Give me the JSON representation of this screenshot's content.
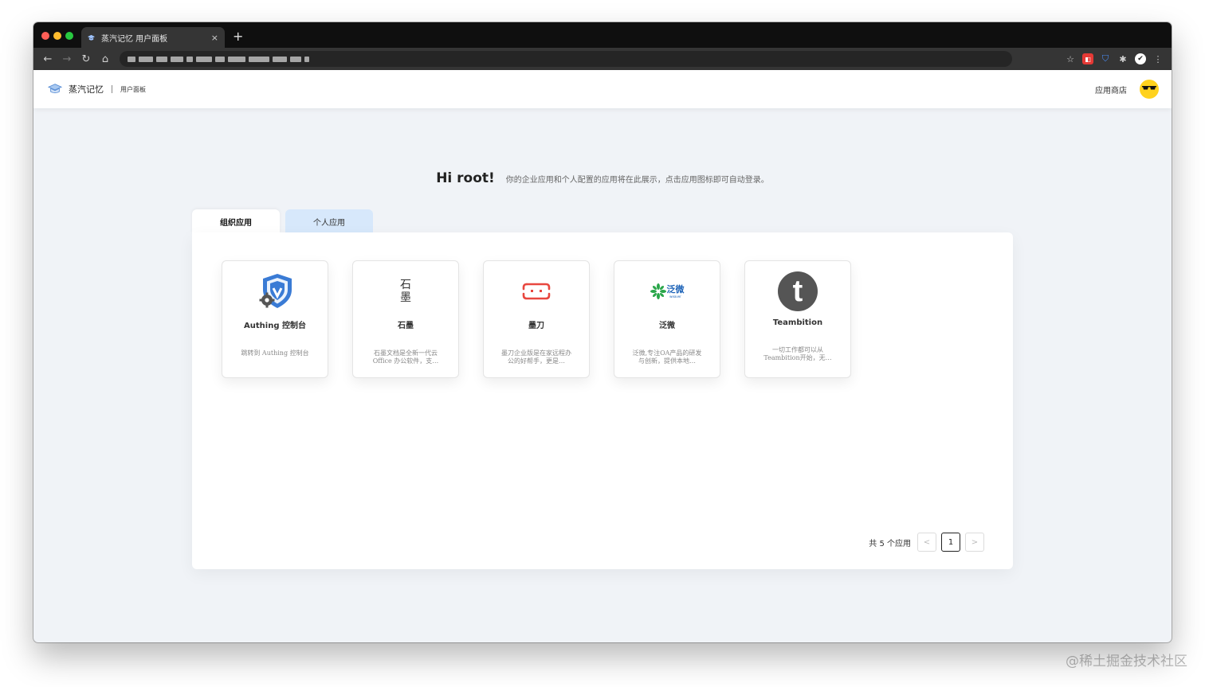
{
  "browser": {
    "tab_title": "蒸汽记忆 用户面板",
    "tab_close": "×",
    "new_tab": "+",
    "nav": {
      "back": "←",
      "forward": "→",
      "reload": "↻",
      "home": "⌂"
    },
    "extensions": {
      "star": "☆",
      "red_ext": "◧",
      "shield": "⛉",
      "puzzle": "✱",
      "profile": "✔",
      "more": "⋮"
    }
  },
  "header": {
    "brand": "蒸汽记忆",
    "divider": "|",
    "subtitle": "用户面板",
    "store_link": "应用商店"
  },
  "greeting": {
    "title": "Hi root!",
    "text": "你的企业应用和个人配置的应用将在此展示，点击应用图标即可自动登录。"
  },
  "tabs": [
    {
      "label": "组织应用",
      "active": true
    },
    {
      "label": "个人应用",
      "active": false
    }
  ],
  "apps": [
    {
      "name": "Authing 控制台",
      "desc": "跳转到 Authing 控制台",
      "icon": "authing-shield-gear-icon"
    },
    {
      "name": "石墨",
      "desc": "石墨文档是全新一代云Office 办公软件，支…",
      "icon": "shimo-logo-icon",
      "icon_text": "石\n墨"
    },
    {
      "name": "墨刀",
      "desc": "墨刀企业版是在家远程办公的好帮手，更是…",
      "icon": "modao-logo-icon"
    },
    {
      "name": "泛微",
      "desc": "泛微,专注OA产品的研发与创新，提供本地…",
      "icon": "weaver-logo-icon",
      "icon_text": "泛微",
      "icon_sub": "weaver"
    },
    {
      "name": "Teambition",
      "desc": "一切工作都可以从Teambition开始，无…",
      "icon": "teambition-logo-icon",
      "icon_text": "t"
    }
  ],
  "pagination": {
    "total_text": "共 5 个应用",
    "prev": "<",
    "next": ">",
    "current_page": "1"
  },
  "watermark": "@稀土掘金技术社区",
  "colors": {
    "page_bg": "#f0f3f7",
    "active_tab_bg": "#ffffff",
    "inactive_tab_bg": "#d7e8fb",
    "authing_blue": "#3a7bd5",
    "modao_red": "#e8473f",
    "weaver_green": "#2aa64a",
    "weaver_blue": "#1d63b8",
    "teambition_gray": "#555555"
  }
}
